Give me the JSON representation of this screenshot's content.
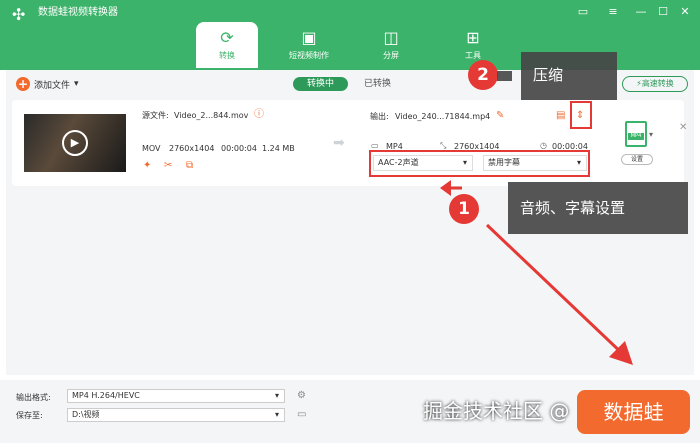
{
  "app": {
    "title": "数据蛙视频转换器"
  },
  "tabs": [
    {
      "label": "转换",
      "icon": "convert-icon"
    },
    {
      "label": "短视频制作",
      "icon": "short-video-icon"
    },
    {
      "label": "分屏",
      "icon": "split-screen-icon"
    },
    {
      "label": "工具",
      "icon": "toolbox-icon"
    }
  ],
  "toolbar": {
    "add_file": "添加文件",
    "converting": "转换中",
    "converted": "已转换",
    "fast_convert": "高速转换"
  },
  "file": {
    "source_label": "源文件:",
    "source_name": "Video_2...844.mov",
    "src_format": "MOV",
    "src_resolution": "2760x1404",
    "src_duration": "00:00:04",
    "src_size": "1.24 MB",
    "output_label": "输出:",
    "output_name": "Video_240...71844.mp4",
    "out_format": "MP4",
    "out_resolution": "2760x1404",
    "out_duration": "00:00:04",
    "audio_select": "AAC-2声道",
    "subtitle_select": "禁用字幕",
    "format_badge": "MP4",
    "settings_label": "设置"
  },
  "annotations": {
    "badge1": "1",
    "callout1": "音频、字幕设置",
    "badge2": "2",
    "callout2": "压缩"
  },
  "bottom": {
    "format_label": "输出格式:",
    "format_value": "MP4 H.264/HEVC",
    "save_label": "保存至:",
    "save_path": "D:\\视频",
    "convert_button": "数据蛙"
  },
  "watermark": "掘金技术社区 @"
}
